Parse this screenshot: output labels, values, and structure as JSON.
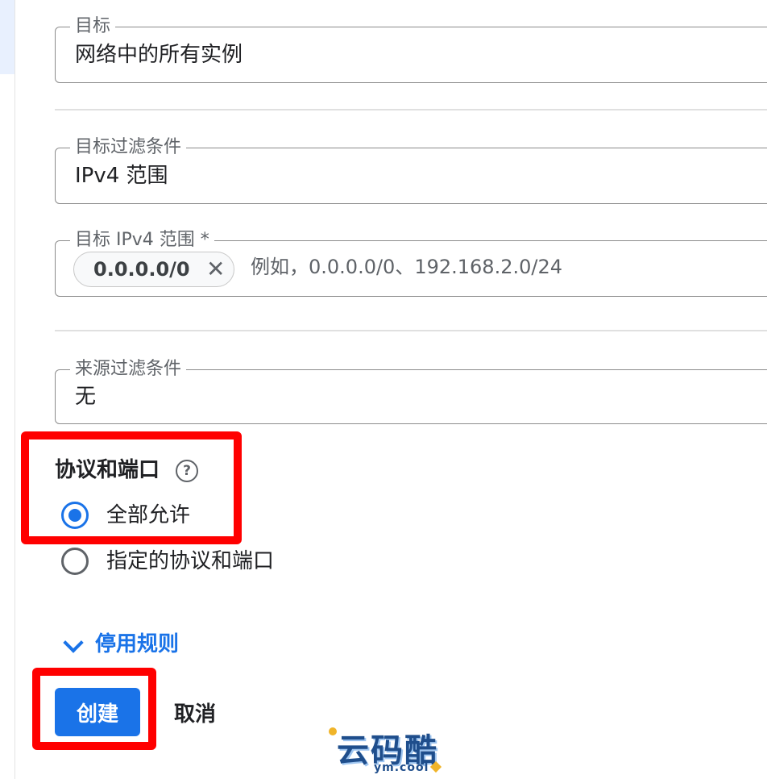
{
  "target": {
    "label": "目标",
    "value": "网络中的所有实例"
  },
  "target_filter": {
    "label": "目标过滤条件",
    "value": "IPv4 范围"
  },
  "target_ipv4_range": {
    "label": "目标 IPv4 范围 *",
    "chips": [
      {
        "value": "0.0.0.0/0",
        "remove_icon": "close-icon",
        "remove_glyph": "✕"
      }
    ],
    "placeholder": "例如，0.0.0.0/0、192.168.2.0/24"
  },
  "source_filter": {
    "label": "来源过滤条件",
    "value": "无"
  },
  "protocols_ports": {
    "title": "协议和端口",
    "help_icon": "help-circle-icon",
    "help_glyph": "?",
    "options": [
      {
        "label": "全部允许",
        "checked": true
      },
      {
        "label": "指定的协议和端口",
        "checked": false
      }
    ]
  },
  "disable_rule": {
    "icon": "chevron-down-icon",
    "label": "停用规则"
  },
  "actions": {
    "create_label": "创建",
    "cancel_label": "取消"
  },
  "watermark": {
    "text": "云码酷",
    "subtext": "ym.cool"
  },
  "colors": {
    "accent": "#1a73e8",
    "highlight": "#ff0000",
    "outline": "#8c8c8c"
  }
}
